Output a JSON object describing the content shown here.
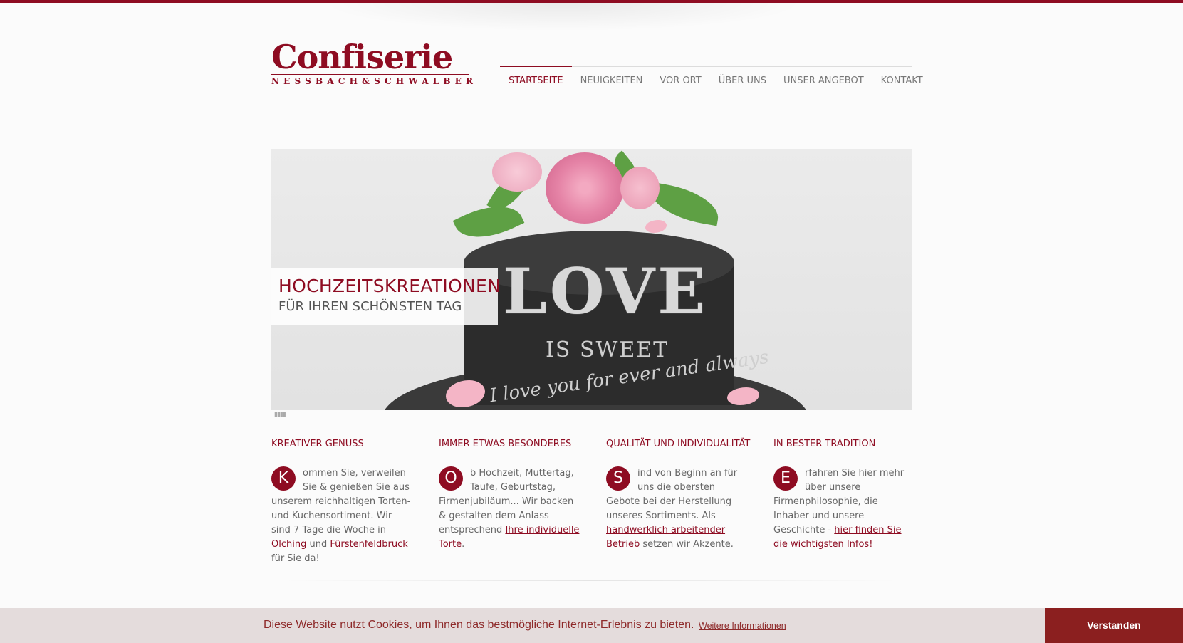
{
  "brand": {
    "name": "Confiserie",
    "tagline": "NESSBACH&SCHWALBER",
    "accent_color": "#8e0c22"
  },
  "nav": {
    "items": [
      {
        "label": "STARTSEITE",
        "active": true
      },
      {
        "label": "NEUIGKEITEN",
        "active": false
      },
      {
        "label": "VOR ORT",
        "active": false
      },
      {
        "label": "ÜBER UNS",
        "active": false
      },
      {
        "label": "UNSER ANGEBOT",
        "active": false
      },
      {
        "label": "KONTAKT",
        "active": false
      }
    ]
  },
  "slider": {
    "title": "HOCHZEITSKREATIONEN",
    "subtitle": "FÜR IHREN SCHÖNSTEN TAG",
    "image_text": {
      "love": "LOVE",
      "sweet": "IS SWEET",
      "script": "I love you for ever and always"
    }
  },
  "columns": [
    {
      "title": "KREATIVER GENUSS",
      "dropcap": "K",
      "text": "ommen Sie, verweilen Sie & genießen Sie aus unserem reichhaltigen Torten- und Kuchensortiment. Wir sind 7 Tage die Woche in ",
      "link1": "Olching",
      "mid": " und ",
      "link2": "Fürstenfeldbruck",
      "end": " für Sie da!"
    },
    {
      "title": "IMMER ETWAS BESONDERES",
      "dropcap": "O",
      "text": "b Hochzeit, Muttertag, Taufe, Geburtstag, Firmenjubiläum... Wir backen & gestalten dem Anlass entsprechend ",
      "link1": "Ihre individuelle Torte",
      "end": "."
    },
    {
      "title": "QUALITÄT UND INDIVIDUALITÄT",
      "dropcap": "S",
      "text": "ind von Beginn an für uns die obersten Gebote bei der Herstellung unseres Sortiments. Als ",
      "link1": "handwerklich arbeitender Betrieb",
      "end": " setzen wir Akzente."
    },
    {
      "title": "IN BESTER TRADITION",
      "dropcap": "E",
      "text": "rfahren Sie hier mehr über unsere Firmenphilosophie, die Inhaber und unsere Geschichte - ",
      "link1": "hier finden Sie die wichtigsten Infos!"
    }
  ],
  "cookie": {
    "message": "Diese Website nutzt Cookies, um Ihnen das bestmögliche Internet-Erlebnis zu bieten.",
    "link": "Weitere Informationen",
    "button": "Verstanden"
  }
}
